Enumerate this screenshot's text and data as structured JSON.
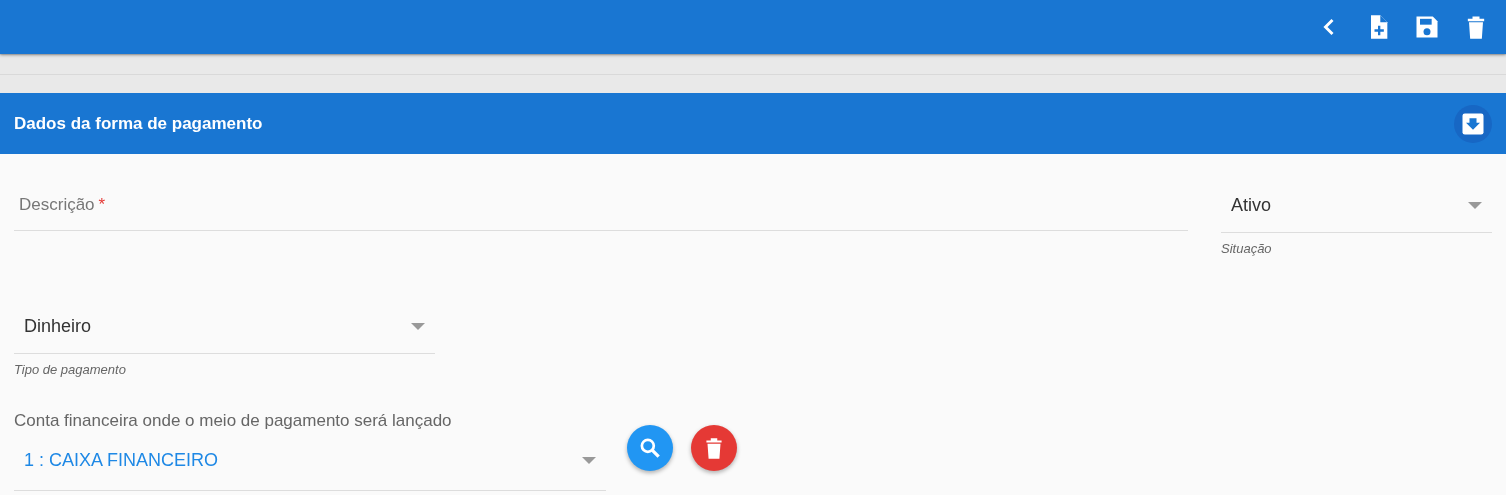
{
  "toolbar": {
    "actions": [
      {
        "kind": "back"
      },
      {
        "kind": "new"
      },
      {
        "kind": "save"
      },
      {
        "kind": "delete"
      }
    ]
  },
  "section": {
    "title": "Dados da forma de pagamento",
    "action": {
      "kind": "collapse"
    }
  },
  "form": {
    "description": {
      "label": "Descrição",
      "required_mark": "*"
    },
    "status": {
      "value": "Ativo",
      "helper": "Situação"
    },
    "payment_type": {
      "value": "Dinheiro",
      "helper": "Tipo de pagamento"
    },
    "account": {
      "label": "Conta financeira onde o meio de pagamento será lançado",
      "value": "1 : CAIXA FINANCEIRO",
      "buttons": [
        {
          "kind": "search"
        },
        {
          "kind": "delete"
        }
      ]
    }
  }
}
